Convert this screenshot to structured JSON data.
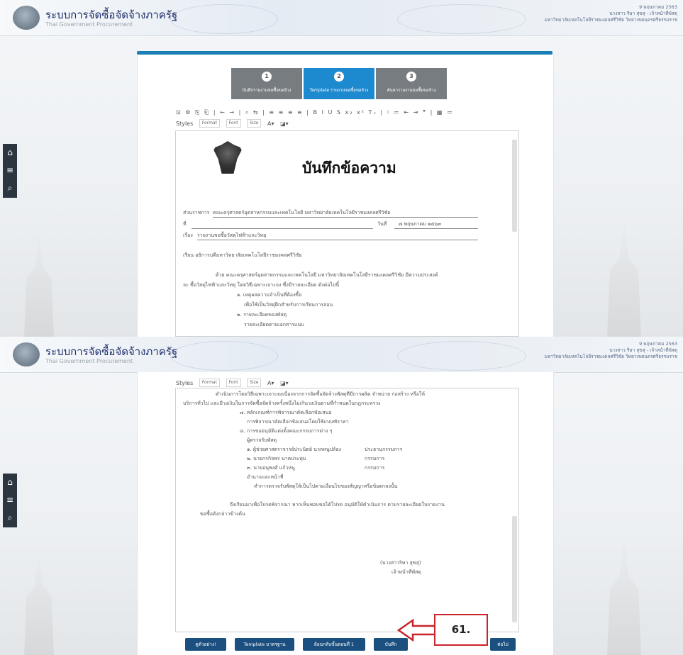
{
  "header": {
    "title": "ระบบการจัดซื้อจัดจ้างภาครัฐ",
    "subtitle": "Thai Government Procurement",
    "info_line1": "9 พฤษภาคม 2563",
    "info_line2": "นางสาว ริษา สุขสุ - เจ้าหน้าที่พัสดุ",
    "info_line3": "มหาวิทยาลัยเทคโนโลยีราชมงคลศรีวิชัย วิทยาเขตนครศรีธรรมราช"
  },
  "sidenav": {
    "home_icon": "⌂",
    "menu_icon": "≡",
    "search_icon": "⌕"
  },
  "steps": [
    {
      "num": "1",
      "label": "บันทึกรายงานขอซื้อขอจ้าง",
      "active": false
    },
    {
      "num": "2",
      "label": "Template รายงานขอซื้อขอจ้าง",
      "active": true
    },
    {
      "num": "3",
      "label": "ค้นหารายงานขอซื้อขอจ้าง",
      "active": false
    }
  ],
  "toolbar": {
    "row1": "⊡ ⚙ ⎘ ⎗ | ← → | ⌕ ⇆ | ≡ ≡ ≡ ≡ | B I U S x₂ x² Tₓ | ⁝ ≔ ⇤ ⇥ ❞ | ▦ ≔",
    "styles": "Styles",
    "format": "Format",
    "font": "Font",
    "size": "Size",
    "color_a": "A▾",
    "color_bg": "◪▾"
  },
  "memo": {
    "title": "บันทึกข้อความ",
    "agency_label": "ส่วนราชการ",
    "agency_value": "คณะครุศาสตร์อุตสาหกรรมและเทคโนโลยี มหาวิทยาลัยเทคโนโลยีราชมงคลศรีวิชัย",
    "no_label": "ที่",
    "date_label": "วันที่",
    "date_value": "๗ พฤษภาคม ๒๕๖๓",
    "subject_label": "เรื่อง",
    "subject_value": "รายงานขอซื้อวัสดุไฟฟ้าและวิทยุ",
    "to_line": "เรียน  อธิการบดีมหาวิทยาลัยเทคโนโลยีราชมงคลศรีวิชัย",
    "para1a": "ด้วย คณะครุศาสตร์อุตสาหกรรมและเทคโนโลยี มหาวิทยาลัยเทคโนโลยีราชมงคลศรีวิชัย มีความประสงค์",
    "para1b": "จะ ซื้อวัสดุไฟฟ้าและวิทยุ โดยวิธีเฉพาะเจาะจง ซึ่งมีรายละเอียด ดังต่อไปนี้",
    "item1": "๑. เหตุผลความจำเป็นที่ต้องซื้อ",
    "item1_detail": "เพื่อใช้เป็นวัสดุฝึกสำหรับการเรียนการสอน",
    "item2": "๒. รายละเอียดของพัสดุ",
    "item2_detail": "รายละเอียดตามเอกสารแนบ"
  },
  "memo2": {
    "l1": "ดำเนินการโดยวิธีเฉพาะเจาะจงเนื่องจากการจัดซื้อจัดจ้างพัสดุที่มีการผลิต จำหน่าย ก่อสร้าง หรือให้",
    "l2": "บริการทั่วไป และมีวงเงินในการจัดซื้อจัดจ้างครั้งหนึ่งไม่เกินวงเงินตามที่กำหนดในกฎกระทรวง",
    "l3": "๗. หลักเกณฑ์การพิจารณาคัดเลือกข้อเสนอ",
    "l4": "การพิจารณาคัดเลือกข้อเสนอโดยใช้เกณฑ์ราคา",
    "l5": "๘. การขออนุมัติแต่งตั้งคณะกรรมการต่าง ๆ",
    "l6": "ผู้ตรวจรับพัสดุ",
    "c1_name": "๑. ผู้ช่วยศาสตราจารย์ประนิตย์ นวลหนูปล้อง",
    "c1_role": "ประธานกรรมการ",
    "c2_name": "๒. นายกรกิจพร นาคประทุม",
    "c2_role": "กรรมการ",
    "c3_name": "๓. นายอนุพงศ์ แก้วหนู",
    "c3_role": "กรรมการ",
    "l7": "อำนาจและหน้าที่",
    "l8": "ทำการตรวจรับพัสดุให้เป็นไปตามเงื่อนไขของสัญญาหรือข้อตกลงนั้น",
    "l9": "จึงเรียนมาเพื่อโปรดพิจารณา หากเห็นชอบขอได้โปรด อนุมัติให้ดำเนินการ ตามรายละเอียดในรายงาน",
    "l10": "ขอซื้อดังกล่าวข้างต้น",
    "sig_name": "(นางสาวริษา สุขสุ)",
    "sig_title": "เจ้าหน้าที่พัสดุ"
  },
  "buttons": {
    "preview": "ดูตัวอย่าง!",
    "template": "Template มาตรฐาน",
    "back": "ย้อนกลับขั้นตอนที่ 1",
    "save": "บันทึก",
    "next": "ต่อไป"
  },
  "annotation": {
    "label": "61."
  }
}
